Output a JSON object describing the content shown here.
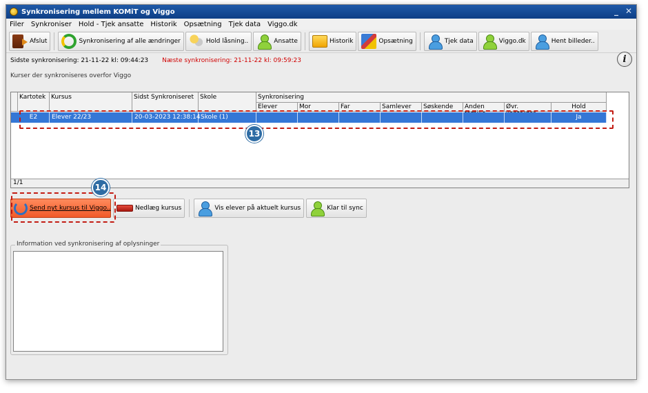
{
  "window": {
    "title": "Synkronisering mellem KOMiT og Viggo",
    "controls": [
      "_",
      "✕"
    ]
  },
  "menu": [
    "Filer",
    "Synkroniser",
    "Hold - Tjek ansatte",
    "Historik",
    "Opsætning",
    "Tjek data",
    "Viggo.dk"
  ],
  "toolbar": {
    "exit": "Afslut",
    "sync_all": "Synkronisering af alle ændringer",
    "hold_lock": "Hold låsning..",
    "staff": "Ansatte",
    "history": "Historik",
    "setup": "Opsætning",
    "check_data": "Tjek data",
    "viggo": "Viggo.dk",
    "fetch_images": "Hent billeder.."
  },
  "status": {
    "last_sync": "Sidste synkronisering: 21-11-22 kl: 09:44:23",
    "next_sync": "Næste synkronisering: 21-11-22 kl: 09:59:23"
  },
  "courses": {
    "group_label": "Kurser der synkroniseres overfor Viggo",
    "headers": [
      "Kartotek",
      "Kursus",
      "Sidst Synkroniseret",
      "Skole",
      "Synkronisering"
    ],
    "sync_subheaders": [
      "Elever",
      "Mor",
      "Far",
      "Samlever",
      "Søskende",
      "Anden familie",
      "Øvr. kontakter",
      "Hold"
    ],
    "rows": [
      {
        "kartotek": "E2",
        "kursus": "Elever 22/23",
        "sidst": "20-03-2023 12:38:14",
        "skole": "Skole (1)",
        "hold": "Ja"
      }
    ],
    "footer": "1/1"
  },
  "badges": {
    "grid": "13",
    "send": "14"
  },
  "actions": {
    "send_new": "Send nyt kursus til Viggo..",
    "close_course": "Nedlæg kursus",
    "show_students": "Vis elever på aktuelt kursus",
    "ready": "Klar til sync"
  },
  "info": {
    "label": "Information ved synkronisering af oplysninger",
    "text": ""
  },
  "colors": {
    "selection": "#3477d6",
    "highlight": "#c21b12",
    "badge": "#2e6ca4",
    "send_button": "#f15a29"
  }
}
